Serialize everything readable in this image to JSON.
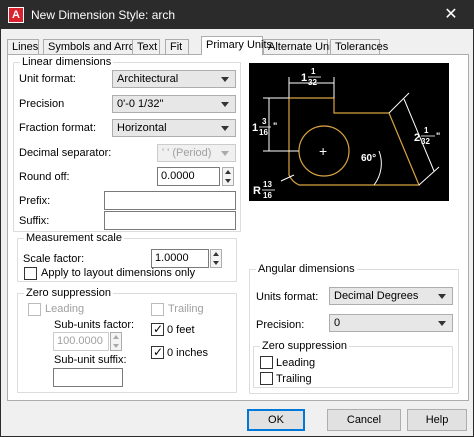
{
  "window": {
    "title": "New Dimension Style: arch",
    "close_glyph": "✕"
  },
  "tabs": [
    "Lines",
    "Symbols and Arrows",
    "Text",
    "Fit",
    "Primary Units",
    "Alternate Units",
    "Tolerances"
  ],
  "linear": {
    "group_label": "Linear dimensions",
    "unit_format_label": "Unit format:",
    "unit_format_value": "Architectural",
    "precision_label": "Precision",
    "precision_value": "0'-0 1/32\"",
    "fraction_format_label": "Fraction format:",
    "fraction_format_value": "Horizontal",
    "decimal_separator_label": "Decimal separator:",
    "decimal_separator_value": "' ' (Period)",
    "round_off_label": "Round off:",
    "round_off_value": "0.0000",
    "prefix_label": "Prefix:",
    "prefix_value": "",
    "suffix_label": "Suffix:",
    "suffix_value": ""
  },
  "measurement_scale": {
    "group_label": "Measurement scale",
    "scale_factor_label": "Scale factor:",
    "scale_factor_value": "1.0000",
    "apply_layout_label": "Apply to layout dimensions only",
    "apply_layout_checked": false
  },
  "zero_suppression": {
    "group_label": "Zero suppression",
    "leading_label": "Leading",
    "trailing_label": "Trailing",
    "sub_units_factor_label": "Sub-units factor:",
    "sub_units_factor_value": "100.0000",
    "sub_unit_suffix_label": "Sub-unit suffix:",
    "sub_unit_suffix_value": "",
    "feet_label": "0 feet",
    "feet_checked": true,
    "inches_label": "0 inches",
    "inches_checked": true
  },
  "angular": {
    "group_label": "Angular dimensions",
    "units_format_label": "Units format:",
    "units_format_value": "Decimal Degrees",
    "precision_label": "Precision:",
    "precision_value": "0",
    "zero_group_label": "Zero suppression",
    "leading_label": "Leading",
    "trailing_label": "Trailing"
  },
  "preview": {
    "top_dim_whole": "1",
    "top_dim_num": "1",
    "top_dim_den": "32",
    "left_dim_whole": "1",
    "left_dim_num": "3",
    "left_dim_den": "16",
    "right_dim_whole": "2",
    "right_dim_num": "1",
    "right_dim_den": "32",
    "radius_prefix": "R",
    "radius_num": "13",
    "radius_den": "16",
    "inch_mark": "\"",
    "angle": "60°",
    "center_mark": "+",
    "line_color": "#ffffff",
    "shape_color": "#d9a441"
  },
  "buttons": {
    "ok": "OK",
    "cancel": "Cancel",
    "help": "Help"
  }
}
